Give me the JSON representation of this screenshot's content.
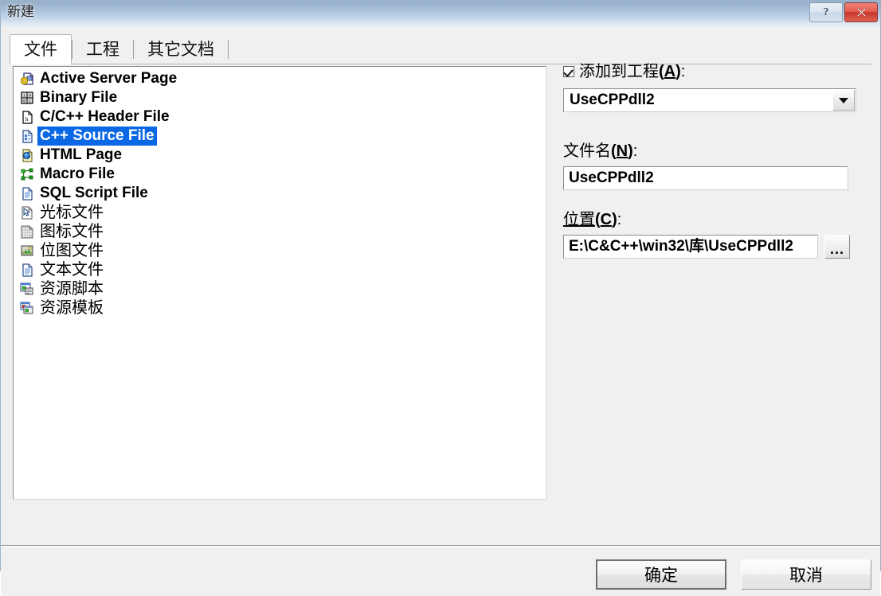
{
  "window": {
    "title": "新建",
    "help_button": "?",
    "close_button": "✕"
  },
  "tabs": [
    {
      "label": "文件",
      "active": true
    },
    {
      "label": "工程",
      "active": false
    },
    {
      "label": "其它文档",
      "active": false
    }
  ],
  "file_list": {
    "items": [
      {
        "label": "Active Server Page",
        "icon": "active-server-page-icon",
        "cjk": false,
        "selected": false
      },
      {
        "label": "Binary File",
        "icon": "binary-file-icon",
        "cjk": false,
        "selected": false
      },
      {
        "label": "C/C++ Header File",
        "icon": "header-file-icon",
        "cjk": false,
        "selected": false
      },
      {
        "label": "C++ Source File",
        "icon": "cpp-source-file-icon",
        "cjk": false,
        "selected": true
      },
      {
        "label": "HTML Page",
        "icon": "html-page-icon",
        "cjk": false,
        "selected": false
      },
      {
        "label": "Macro File",
        "icon": "macro-file-icon",
        "cjk": false,
        "selected": false
      },
      {
        "label": "SQL Script File",
        "icon": "sql-script-file-icon",
        "cjk": false,
        "selected": false
      },
      {
        "label": "光标文件",
        "icon": "cursor-file-icon",
        "cjk": true,
        "selected": false
      },
      {
        "label": "图标文件",
        "icon": "icon-file-icon",
        "cjk": true,
        "selected": false
      },
      {
        "label": "位图文件",
        "icon": "bitmap-file-icon",
        "cjk": true,
        "selected": false
      },
      {
        "label": "文本文件",
        "icon": "text-file-icon",
        "cjk": true,
        "selected": false
      },
      {
        "label": "资源脚本",
        "icon": "resource-script-icon",
        "cjk": true,
        "selected": false
      },
      {
        "label": "资源模板",
        "icon": "resource-template-icon",
        "cjk": true,
        "selected": false
      }
    ]
  },
  "right_panel": {
    "add_to_project": {
      "label_prefix": "添加到工程",
      "accel": "A",
      "label_suffix": ":",
      "checked": true
    },
    "project_combo": {
      "value": "UseCPPdll2"
    },
    "file_name": {
      "label_prefix": "文件名",
      "accel": "N",
      "label_suffix": ":",
      "value": "UseCPPdll2"
    },
    "location": {
      "label_prefix": "位置",
      "accel": "C",
      "label_suffix": ":",
      "value": "E:\\C&C++\\win32\\库\\UseCPPdll2",
      "browse_button": "..."
    }
  },
  "footer": {
    "ok_label": "确定",
    "cancel_label": "取消"
  },
  "colors": {
    "selection_blue": "#0b68e4",
    "dialog_bg": "#f0f0f0",
    "titlebar_top": "#93aecb",
    "titlebar_bottom": "#eff3f9",
    "close_red": "#c9362a"
  }
}
